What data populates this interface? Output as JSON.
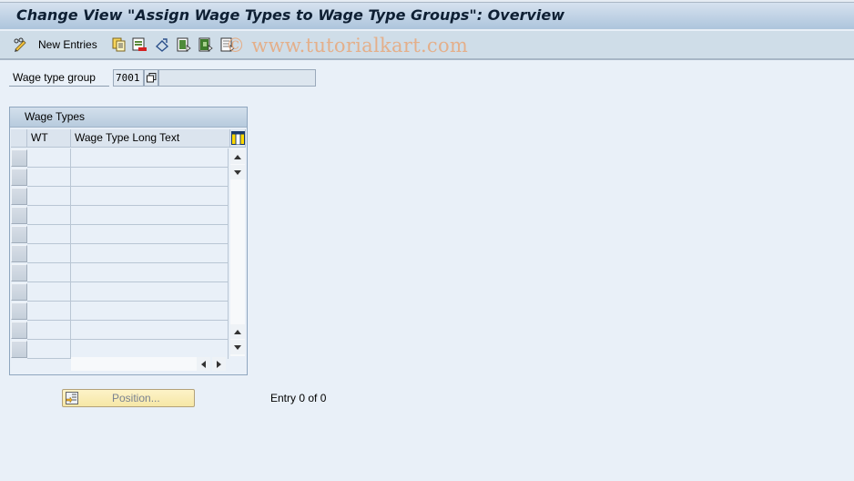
{
  "window": {
    "title": "Change View \"Assign Wage Types to Wage Type Groups\": Overview"
  },
  "toolbar": {
    "items": [
      {
        "name": "display-change-toggle",
        "icon": "pencil-glasses-icon"
      },
      {
        "name": "new-entries",
        "label": "New Entries"
      },
      {
        "name": "copy-as",
        "icon": "copy-icon"
      },
      {
        "name": "delete",
        "icon": "delete-icon"
      },
      {
        "name": "undo-change",
        "icon": "undo-icon"
      },
      {
        "name": "select-all",
        "icon": "select-all-icon"
      },
      {
        "name": "select-block",
        "icon": "select-block-icon"
      },
      {
        "name": "deselect-all",
        "icon": "deselect-all-icon"
      }
    ],
    "new_entries_label": "New Entries"
  },
  "watermark": "© www.tutorialkart.com",
  "form": {
    "wage_type_group_label": "Wage type group",
    "wage_type_group_value": "7001",
    "wage_type_group_description": ""
  },
  "table": {
    "title": "Wage Types",
    "columns": [
      {
        "key": "wt",
        "label": "WT"
      },
      {
        "key": "long_text",
        "label": "Wage Type Long Text"
      }
    ],
    "rows": [
      {
        "wt": "",
        "long_text": ""
      },
      {
        "wt": "",
        "long_text": ""
      },
      {
        "wt": "",
        "long_text": ""
      },
      {
        "wt": "",
        "long_text": ""
      },
      {
        "wt": "",
        "long_text": ""
      },
      {
        "wt": "",
        "long_text": ""
      },
      {
        "wt": "",
        "long_text": ""
      },
      {
        "wt": "",
        "long_text": ""
      },
      {
        "wt": "",
        "long_text": ""
      },
      {
        "wt": "",
        "long_text": ""
      },
      {
        "wt": "",
        "long_text": ""
      }
    ]
  },
  "footer": {
    "position_button_label": "Position...",
    "entry_counter": "Entry 0 of 0"
  },
  "colors": {
    "background": "#e9f0f8",
    "titlebar": "#adc5dc",
    "toolbar": "#cfdde8",
    "position_button": "#f6e7a6"
  }
}
